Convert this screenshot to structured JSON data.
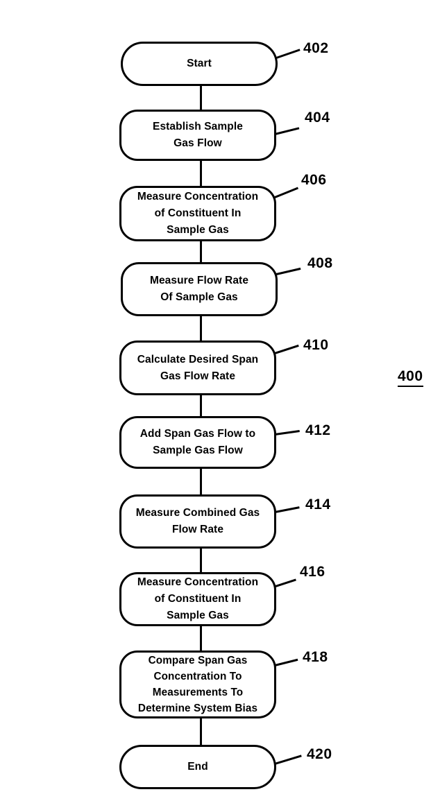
{
  "figure": {
    "number": "400",
    "type": "patent-flowchart"
  },
  "nodes": [
    {
      "id": "402",
      "label": "Start",
      "shape": "terminator"
    },
    {
      "id": "404",
      "label": "Establish Sample\nGas Flow",
      "shape": "process"
    },
    {
      "id": "406",
      "label": "Measure Concentration\nof Constituent In\nSample Gas",
      "shape": "process"
    },
    {
      "id": "408",
      "label": "Measure Flow Rate\nOf Sample Gas",
      "shape": "process"
    },
    {
      "id": "410",
      "label": "Calculate Desired Span\nGas Flow Rate",
      "shape": "process"
    },
    {
      "id": "412",
      "label": "Add Span Gas Flow to\nSample Gas Flow",
      "shape": "process"
    },
    {
      "id": "414",
      "label": "Measure Combined Gas\nFlow Rate",
      "shape": "process"
    },
    {
      "id": "416",
      "label": "Measure Concentration\nof Constituent In\nSample Gas",
      "shape": "process"
    },
    {
      "id": "418",
      "label": "Compare Span Gas\nConcentration To\nMeasurements To\nDetermine System Bias",
      "shape": "process"
    },
    {
      "id": "420",
      "label": "End",
      "shape": "terminator"
    }
  ],
  "colors": {
    "stroke": "#000000",
    "background": "#ffffff"
  }
}
